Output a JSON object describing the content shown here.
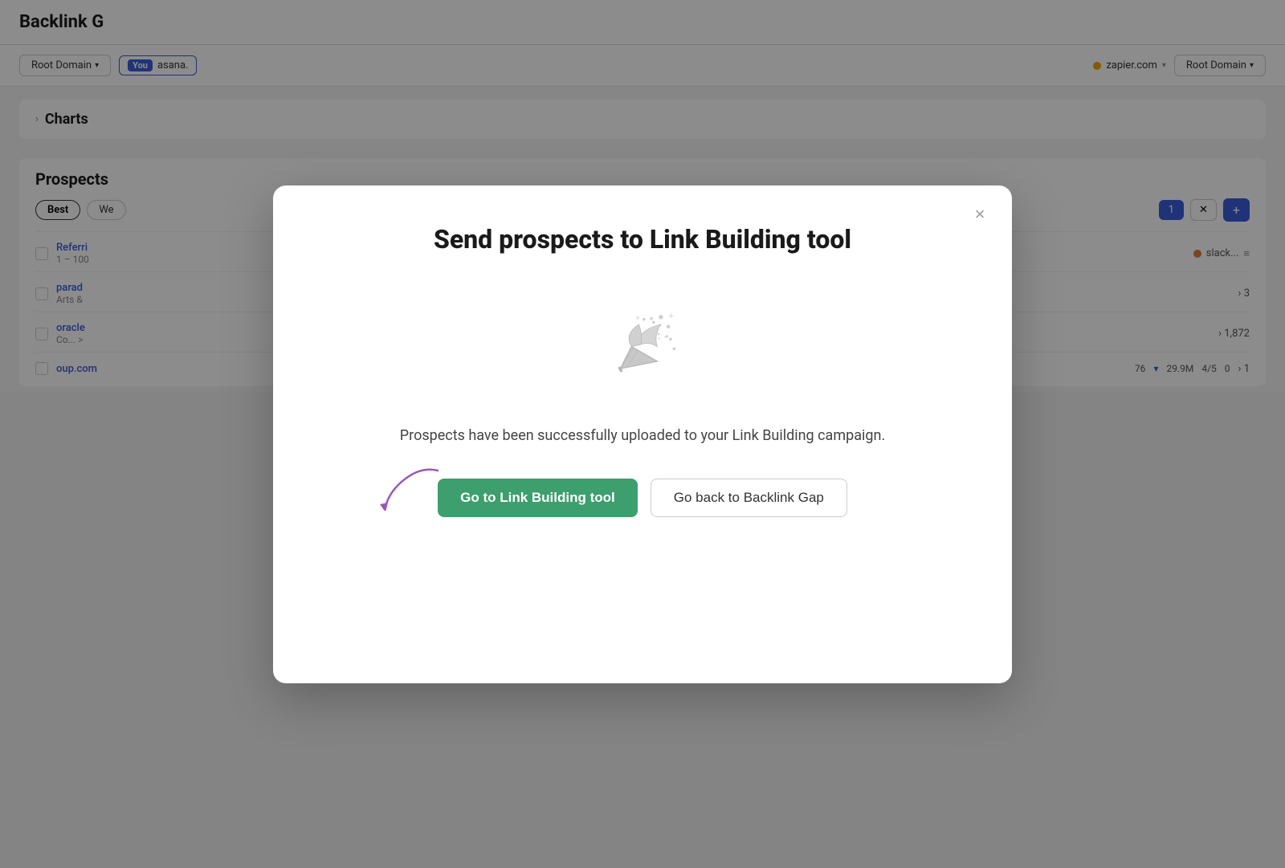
{
  "background": {
    "page_title": "Backlink G",
    "root_domain_label": "Root Domain",
    "you_label": "You",
    "domain_you": "asana.",
    "zapier_domain": "zapier.com",
    "charts_label": "Charts",
    "prospects_label": "Prospects",
    "best_tab": "Best",
    "we_tab": "We",
    "filter_count": "1",
    "referring_row": {
      "name": "Referri",
      "range": "1 – 100"
    },
    "parad_row": {
      "name": "parad",
      "category": "Arts &",
      "count": "3"
    },
    "oracle_row": {
      "name": "oracle",
      "category": "Co... >",
      "count": "1,872"
    },
    "oup_row": {
      "name": "oup.com",
      "count1": "76",
      "count2": "29.9M",
      "count3": "4/5",
      "count4": "0",
      "count5": "1"
    }
  },
  "modal": {
    "title": "Send prospects to Link Building tool",
    "close_label": "×",
    "message": "Prospects have been successfully uploaded to your Link Building campaign.",
    "btn_primary_label": "Go to Link Building tool",
    "btn_secondary_label": "Go back to Backlink Gap"
  }
}
